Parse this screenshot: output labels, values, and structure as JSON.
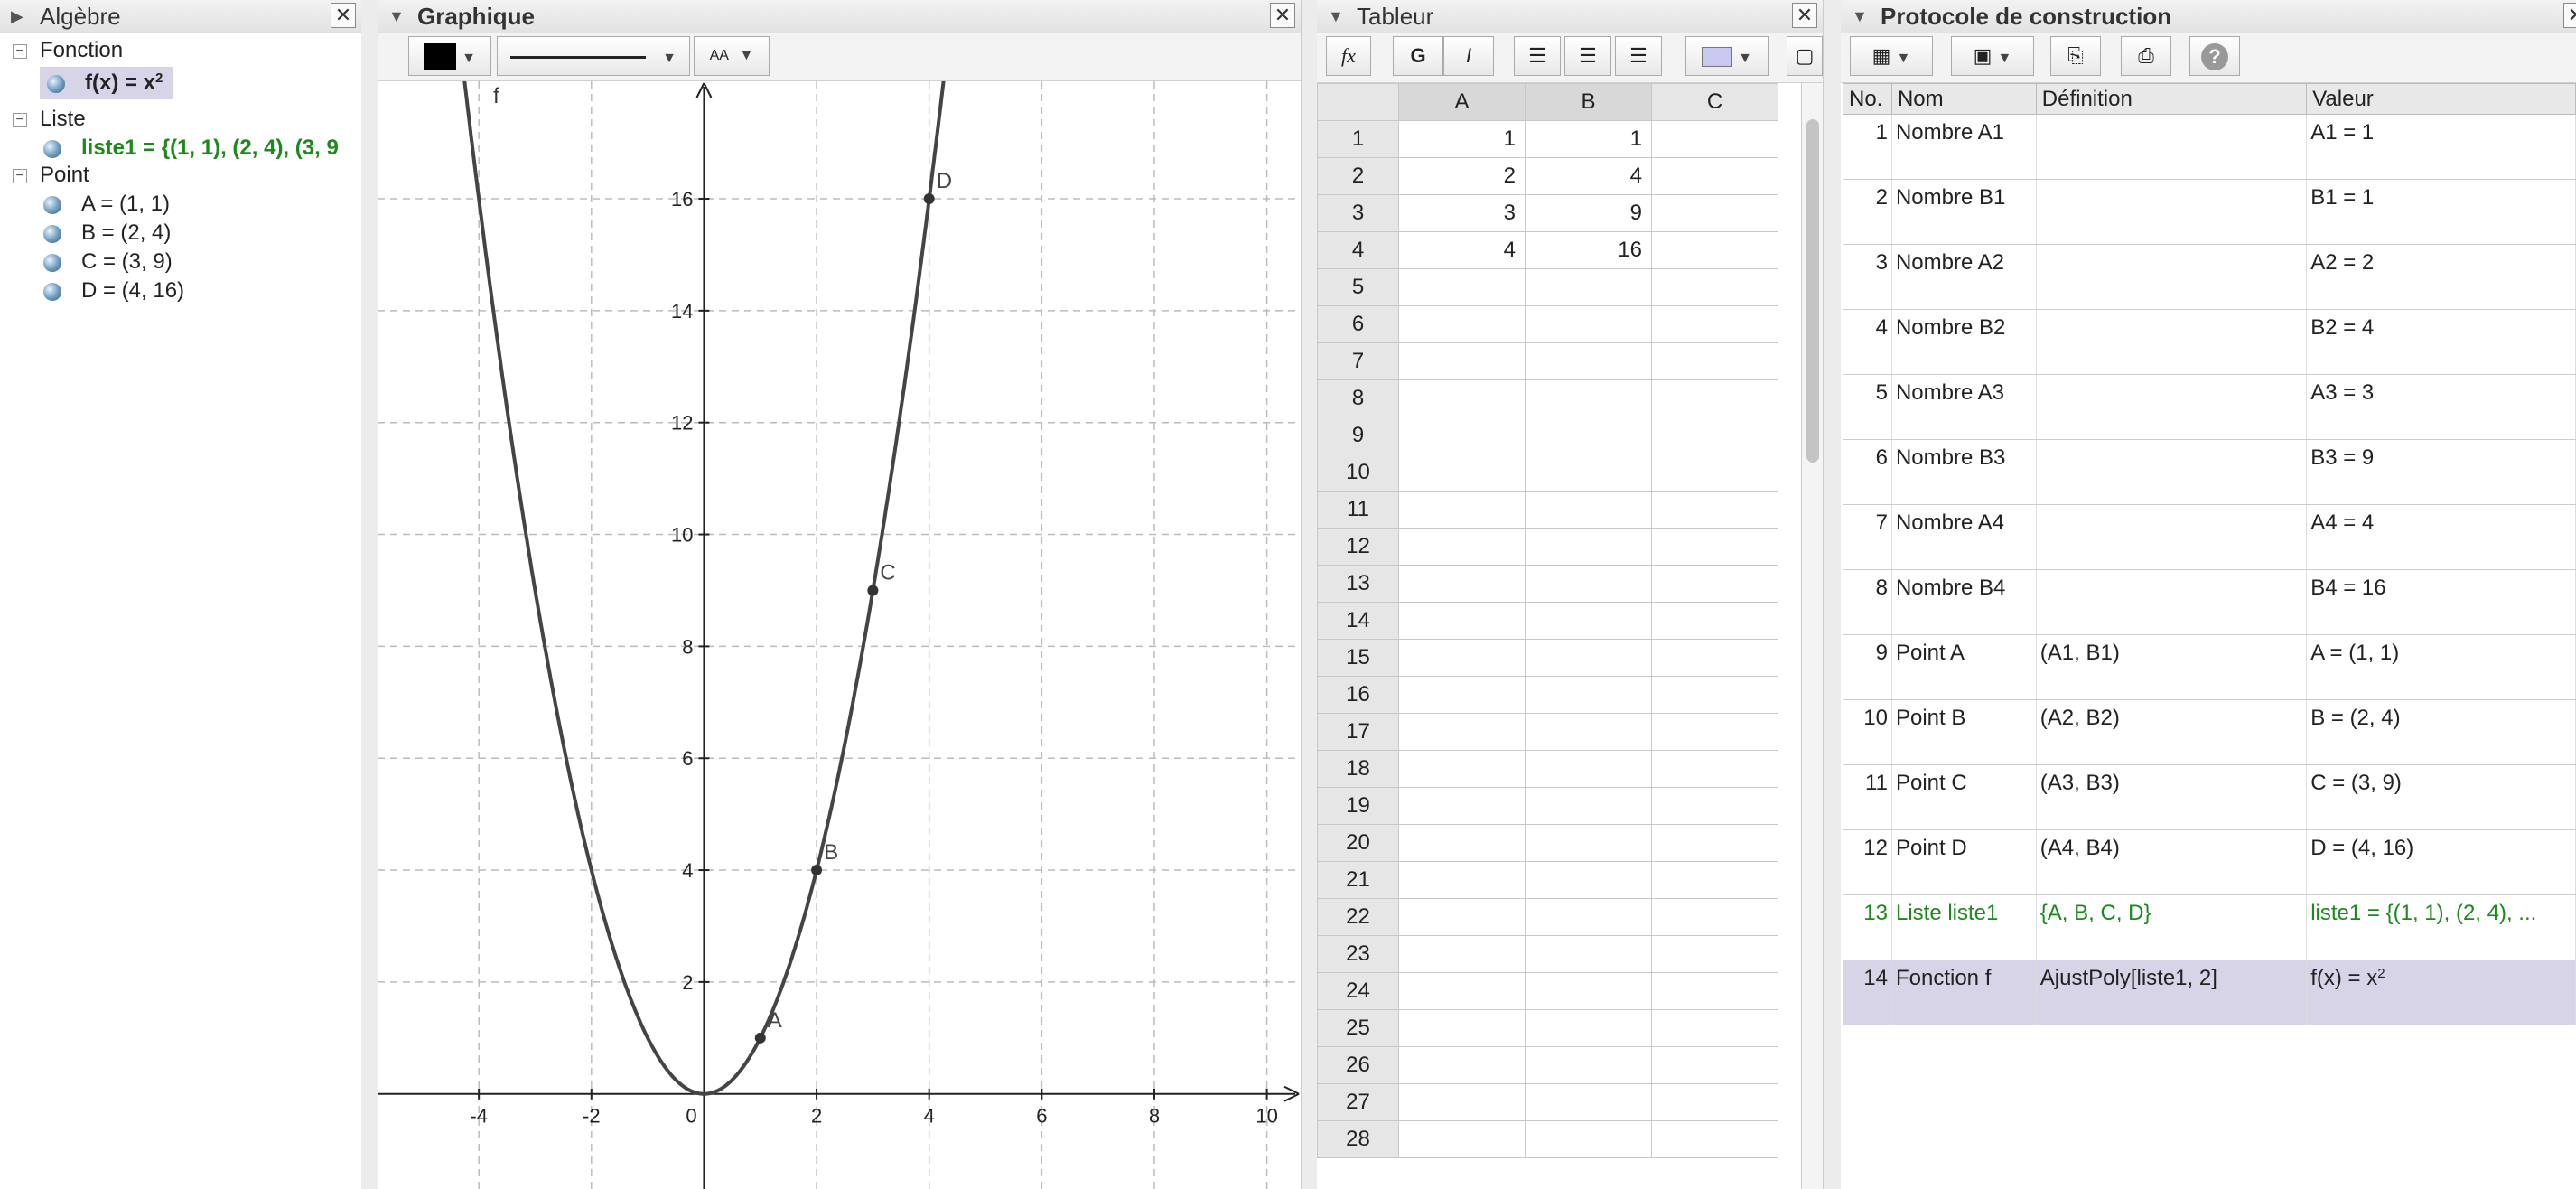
{
  "algebra": {
    "title": "Algèbre",
    "categories": [
      {
        "label": "Fonction",
        "items": [
          {
            "text": "f(x) = x",
            "sup": "2"
          }
        ]
      },
      {
        "label": "Liste",
        "items": [
          {
            "text": "liste1 = {(1, 1), (2, 4), (3, 9"
          }
        ]
      },
      {
        "label": "Point",
        "items": [
          {
            "text": "A = (1, 1)"
          },
          {
            "text": "B = (2, 4)"
          },
          {
            "text": "C = (3, 9)"
          },
          {
            "text": "D = (4, 16)"
          }
        ]
      }
    ]
  },
  "graph": {
    "title": "Graphique",
    "text_style": "AA",
    "function_label": "f",
    "x_ticks": [
      "-4",
      "-2",
      "0",
      "2",
      "4",
      "6",
      "8",
      "10"
    ],
    "y_ticks": [
      "2",
      "4",
      "6",
      "8",
      "10",
      "12",
      "14",
      "16"
    ],
    "points": [
      {
        "label": "A",
        "x": 1,
        "y": 1
      },
      {
        "label": "B",
        "x": 2,
        "y": 4
      },
      {
        "label": "C",
        "x": 3,
        "y": 9
      },
      {
        "label": "D",
        "x": 4,
        "y": 16
      }
    ],
    "x_range": [
      -5.8,
      10.6
    ],
    "y_range": [
      -1.7,
      18.1
    ],
    "colors": {
      "curve": "#444444",
      "grid": "#bbbbbb",
      "axis": "#222222"
    }
  },
  "sheet": {
    "title": "Tableur",
    "fx": "fx",
    "bold": "G",
    "italic": "I",
    "columns": [
      "A",
      "B",
      "C"
    ],
    "rows": [
      {
        "n": "1",
        "a": "1",
        "b": "1"
      },
      {
        "n": "2",
        "a": "2",
        "b": "4"
      },
      {
        "n": "3",
        "a": "3",
        "b": "9"
      },
      {
        "n": "4",
        "a": "4",
        "b": "16"
      },
      {
        "n": "5",
        "a": "",
        "b": ""
      },
      {
        "n": "6",
        "a": "",
        "b": ""
      },
      {
        "n": "7",
        "a": "",
        "b": ""
      },
      {
        "n": "8",
        "a": "",
        "b": ""
      },
      {
        "n": "9",
        "a": "",
        "b": ""
      },
      {
        "n": "10",
        "a": "",
        "b": ""
      },
      {
        "n": "11",
        "a": "",
        "b": ""
      },
      {
        "n": "12",
        "a": "",
        "b": ""
      },
      {
        "n": "13",
        "a": "",
        "b": ""
      },
      {
        "n": "14",
        "a": "",
        "b": ""
      },
      {
        "n": "15",
        "a": "",
        "b": ""
      },
      {
        "n": "16",
        "a": "",
        "b": ""
      },
      {
        "n": "17",
        "a": "",
        "b": ""
      },
      {
        "n": "18",
        "a": "",
        "b": ""
      },
      {
        "n": "19",
        "a": "",
        "b": ""
      },
      {
        "n": "20",
        "a": "",
        "b": ""
      },
      {
        "n": "21",
        "a": "",
        "b": ""
      },
      {
        "n": "22",
        "a": "",
        "b": ""
      },
      {
        "n": "23",
        "a": "",
        "b": ""
      },
      {
        "n": "24",
        "a": "",
        "b": ""
      },
      {
        "n": "25",
        "a": "",
        "b": ""
      },
      {
        "n": "26",
        "a": "",
        "b": ""
      },
      {
        "n": "27",
        "a": "",
        "b": ""
      },
      {
        "n": "28",
        "a": "",
        "b": ""
      }
    ]
  },
  "protocol": {
    "title": "Protocole de construction",
    "headers": [
      "No.",
      "Nom",
      "Définition",
      "Valeur"
    ],
    "rows": [
      {
        "no": "1",
        "nom": "Nombre A1",
        "def": "",
        "val": "A1 = 1"
      },
      {
        "no": "2",
        "nom": "Nombre B1",
        "def": "",
        "val": "B1 = 1"
      },
      {
        "no": "3",
        "nom": "Nombre A2",
        "def": "",
        "val": "A2 = 2"
      },
      {
        "no": "4",
        "nom": "Nombre B2",
        "def": "",
        "val": "B2 = 4"
      },
      {
        "no": "5",
        "nom": "Nombre A3",
        "def": "",
        "val": "A3 = 3"
      },
      {
        "no": "6",
        "nom": "Nombre B3",
        "def": "",
        "val": "B3 = 9"
      },
      {
        "no": "7",
        "nom": "Nombre A4",
        "def": "",
        "val": "A4 = 4"
      },
      {
        "no": "8",
        "nom": "Nombre B4",
        "def": "",
        "val": "B4 = 16"
      },
      {
        "no": "9",
        "nom": "Point A",
        "def": "(A1, B1)",
        "val": "A = (1, 1)"
      },
      {
        "no": "10",
        "nom": "Point B",
        "def": "(A2, B2)",
        "val": "B = (2, 4)"
      },
      {
        "no": "11",
        "nom": "Point C",
        "def": "(A3, B3)",
        "val": "C = (3, 9)"
      },
      {
        "no": "12",
        "nom": "Point D",
        "def": "(A4, B4)",
        "val": "D = (4, 16)"
      },
      {
        "no": "13",
        "nom": "Liste liste1",
        "def": "{A, B, C, D}",
        "val": "liste1 = {(1, 1), (2, 4), ..."
      },
      {
        "no": "14",
        "nom": "Fonction f",
        "def": "AjustPoly[liste1, 2]",
        "val": "f(x) = x",
        "sup": "2"
      }
    ]
  }
}
